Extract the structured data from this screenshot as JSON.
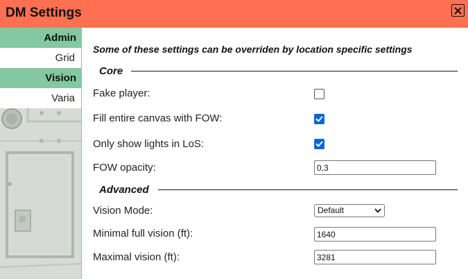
{
  "window": {
    "title": "DM Settings",
    "close_icon": "close-icon"
  },
  "sidebar": {
    "sections": [
      {
        "header": "Admin",
        "items": [
          "Grid"
        ]
      },
      {
        "header": "Vision",
        "items": [
          "Varia"
        ]
      }
    ]
  },
  "intro": "Some of these settings can be overriden by location specific settings",
  "sections": {
    "core": {
      "title": "Core",
      "fake_player": {
        "label": "Fake player:",
        "checked": false
      },
      "fill_canvas": {
        "label": "Fill entire canvas with FOW:",
        "checked": true
      },
      "lights_los": {
        "label": "Only show lights in LoS:",
        "checked": true
      },
      "fow_opacity": {
        "label": "FOW opacity:",
        "value": "0,3"
      }
    },
    "advanced": {
      "title": "Advanced",
      "vision_mode": {
        "label": "Vision Mode:",
        "selected": "Default"
      },
      "min_vision": {
        "label": "Minimal full vision (ft):",
        "value": "1640"
      },
      "max_vision": {
        "label": "Maximal vision (ft):",
        "value": "3281"
      }
    }
  },
  "colors": {
    "titlebar": "#ff7052",
    "sidebar_accent": "#82c8a0",
    "checkbox_checked": "#0a66d8"
  }
}
